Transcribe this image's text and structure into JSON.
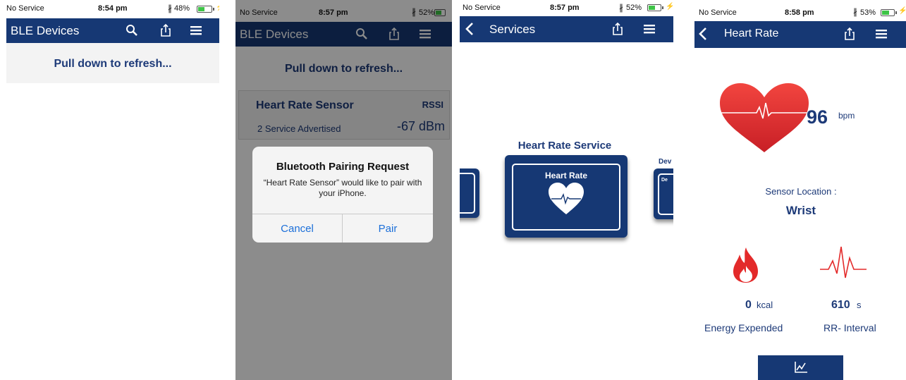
{
  "colors": {
    "navbar": "#163874",
    "accent_text": "#1d3a78",
    "ios_blue": "#1b6fd9",
    "heart_red": "#e8303a",
    "battery_green": "#3ec447"
  },
  "screen1": {
    "status": {
      "carrier": "No Service",
      "time": "8:54 pm",
      "battery": "48%"
    },
    "nav": {
      "title": "BLE Devices",
      "icons": [
        "search-icon",
        "share-icon",
        "menu-icon"
      ]
    },
    "refresh_hint": "Pull down to refresh..."
  },
  "screen2": {
    "status": {
      "carrier": "No Service",
      "time": "8:57 pm",
      "battery": "52%"
    },
    "nav": {
      "title": "BLE Devices",
      "icons": [
        "search-icon",
        "share-icon",
        "menu-icon"
      ]
    },
    "refresh_hint": "Pull down to refresh...",
    "device": {
      "name": "Heart Rate Sensor",
      "rssi_label": "RSSI",
      "services": "2 Service Advertised",
      "rssi_value": "-67 dBm"
    },
    "dialog": {
      "title": "Bluetooth Pairing Request",
      "message": "“Heart Rate Sensor” would like to pair with your iPhone.",
      "cancel": "Cancel",
      "pair": "Pair"
    }
  },
  "screen3": {
    "status": {
      "carrier": "No Service",
      "time": "8:57 pm",
      "battery": "52%"
    },
    "nav": {
      "title": "Services",
      "icons": [
        "back-icon",
        "share-icon",
        "menu-icon"
      ]
    },
    "service_title": "Heart Rate Service",
    "card_label": "Heart Rate",
    "right_card_title": "Dev",
    "right_card_label": "De"
  },
  "screen4": {
    "status": {
      "carrier": "No Service",
      "time": "8:58 pm",
      "battery": "53%"
    },
    "nav": {
      "title": "Heart Rate",
      "icons": [
        "back-icon",
        "share-icon",
        "menu-icon"
      ]
    },
    "bpm_value": "96",
    "bpm_unit": "bpm",
    "sensor_location_label": "Sensor Location :",
    "sensor_location_value": "Wrist",
    "energy_value": "0",
    "energy_unit": "kcal",
    "energy_label": "Energy Expended",
    "rr_value": "610",
    "rr_unit": "s",
    "rr_label": "RR- Interval",
    "bottom_icon": "chart-icon"
  }
}
